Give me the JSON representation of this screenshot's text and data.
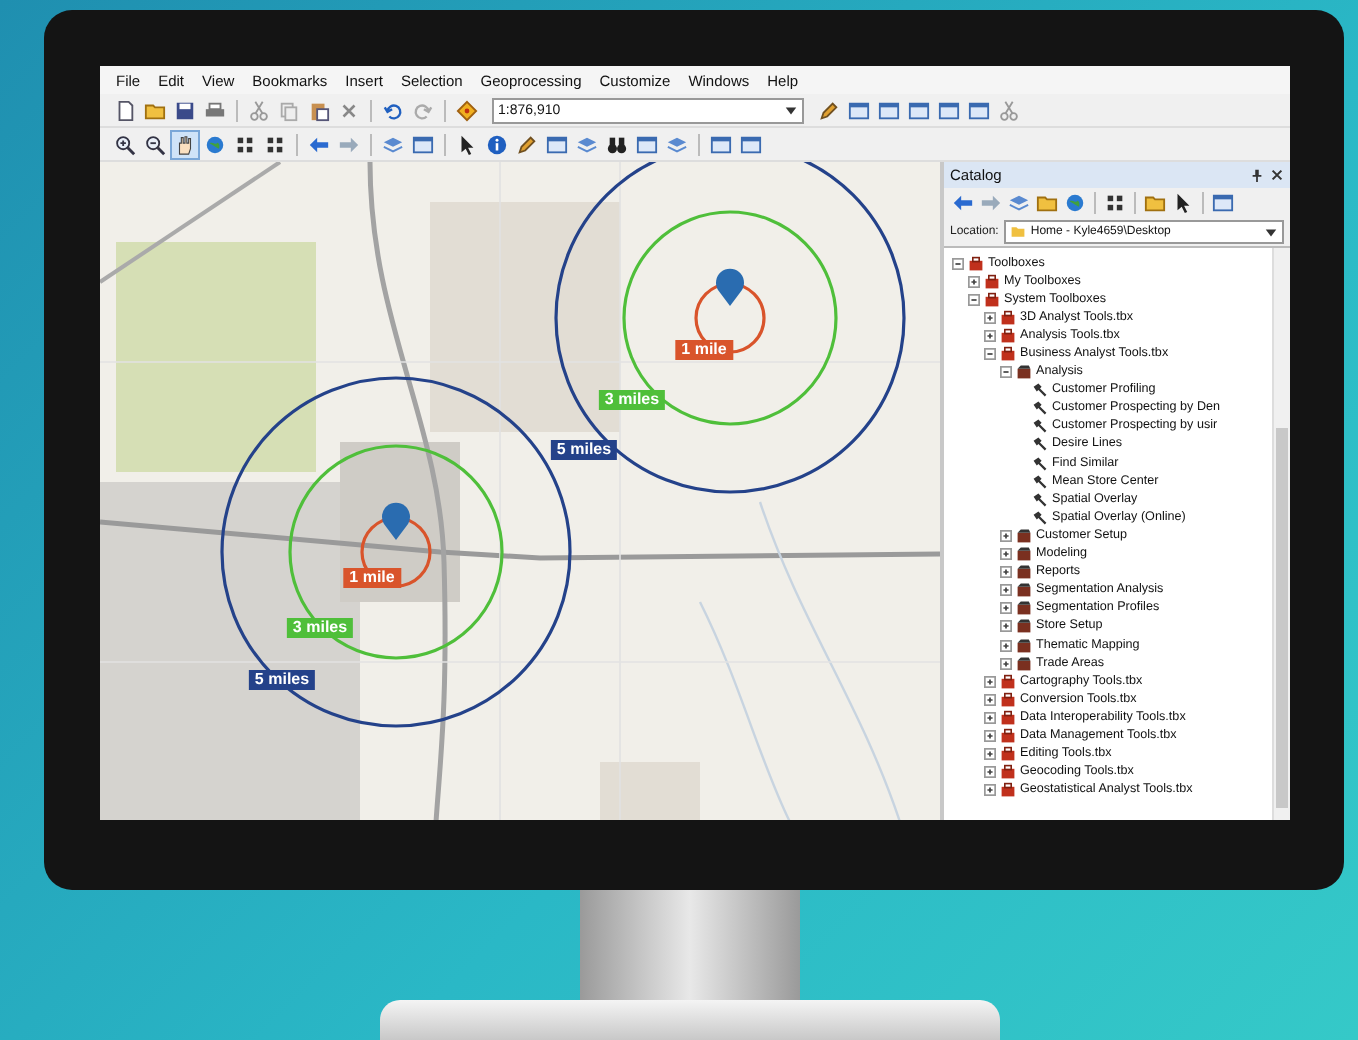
{
  "menu": [
    "File",
    "Edit",
    "View",
    "Bookmarks",
    "Insert",
    "Selection",
    "Geoprocessing",
    "Customize",
    "Windows",
    "Help"
  ],
  "scale": {
    "value": "1:876,910"
  },
  "map": {
    "sites": [
      {
        "rings": [
          {
            "label": "1 mile",
            "color": "#d9542b"
          },
          {
            "label": "3 miles",
            "color": "#4fbf3a"
          },
          {
            "label": "5 miles",
            "color": "#24428a"
          }
        ]
      },
      {
        "rings": [
          {
            "label": "1 mile",
            "color": "#d9542b"
          },
          {
            "label": "3 miles",
            "color": "#4fbf3a"
          },
          {
            "label": "5 miles",
            "color": "#24428a"
          }
        ]
      }
    ]
  },
  "catalog": {
    "title": "Catalog",
    "location_label": "Location:",
    "location": "Home - Kyle4659\\Desktop",
    "tree": [
      {
        "kind": "folder",
        "label": "Toolboxes",
        "expanded": true,
        "children": [
          {
            "kind": "folder",
            "label": "My Toolboxes",
            "expanded": false
          },
          {
            "kind": "folder",
            "label": "System Toolboxes",
            "expanded": true,
            "children": [
              {
                "kind": "toolbox",
                "label": "3D Analyst Tools.tbx",
                "expanded": false
              },
              {
                "kind": "toolbox",
                "label": "Analysis Tools.tbx",
                "expanded": false
              },
              {
                "kind": "toolbox",
                "label": "Business Analyst Tools.tbx",
                "expanded": true,
                "children": [
                  {
                    "kind": "toolset",
                    "label": "Analysis",
                    "expanded": true,
                    "children": [
                      {
                        "kind": "tool",
                        "label": "Customer Profiling"
                      },
                      {
                        "kind": "tool",
                        "label": "Customer Prospecting by Den"
                      },
                      {
                        "kind": "tool",
                        "label": "Customer Prospecting by usir"
                      },
                      {
                        "kind": "tool",
                        "label": "Desire Lines"
                      },
                      {
                        "kind": "tool",
                        "label": "Find Similar"
                      },
                      {
                        "kind": "tool",
                        "label": "Mean Store Center"
                      },
                      {
                        "kind": "tool",
                        "label": "Spatial Overlay"
                      },
                      {
                        "kind": "tool",
                        "label": "Spatial Overlay (Online)"
                      }
                    ]
                  },
                  {
                    "kind": "toolset",
                    "label": "Customer Setup",
                    "expanded": false
                  },
                  {
                    "kind": "toolset",
                    "label": "Modeling",
                    "expanded": false
                  },
                  {
                    "kind": "toolset",
                    "label": "Reports",
                    "expanded": false
                  },
                  {
                    "kind": "toolset",
                    "label": "Segmentation Analysis",
                    "expanded": false
                  },
                  {
                    "kind": "toolset",
                    "label": "Segmentation Profiles",
                    "expanded": false
                  },
                  {
                    "kind": "toolset",
                    "label": "Store Setup",
                    "expanded": false
                  },
                  {
                    "kind": "toolset",
                    "label": "Thematic Mapping",
                    "expanded": false
                  },
                  {
                    "kind": "toolset",
                    "label": "Trade Areas",
                    "expanded": false
                  }
                ]
              },
              {
                "kind": "toolbox",
                "label": "Cartography Tools.tbx",
                "expanded": false
              },
              {
                "kind": "toolbox",
                "label": "Conversion Tools.tbx",
                "expanded": false
              },
              {
                "kind": "toolbox",
                "label": "Data Interoperability Tools.tbx",
                "expanded": false
              },
              {
                "kind": "toolbox",
                "label": "Data Management Tools.tbx",
                "expanded": false
              },
              {
                "kind": "toolbox",
                "label": "Editing Tools.tbx",
                "expanded": false
              },
              {
                "kind": "toolbox",
                "label": "Geocoding Tools.tbx",
                "expanded": false
              },
              {
                "kind": "toolbox",
                "label": "Geostatistical Analyst Tools.tbx",
                "expanded": false
              }
            ]
          }
        ]
      }
    ]
  }
}
